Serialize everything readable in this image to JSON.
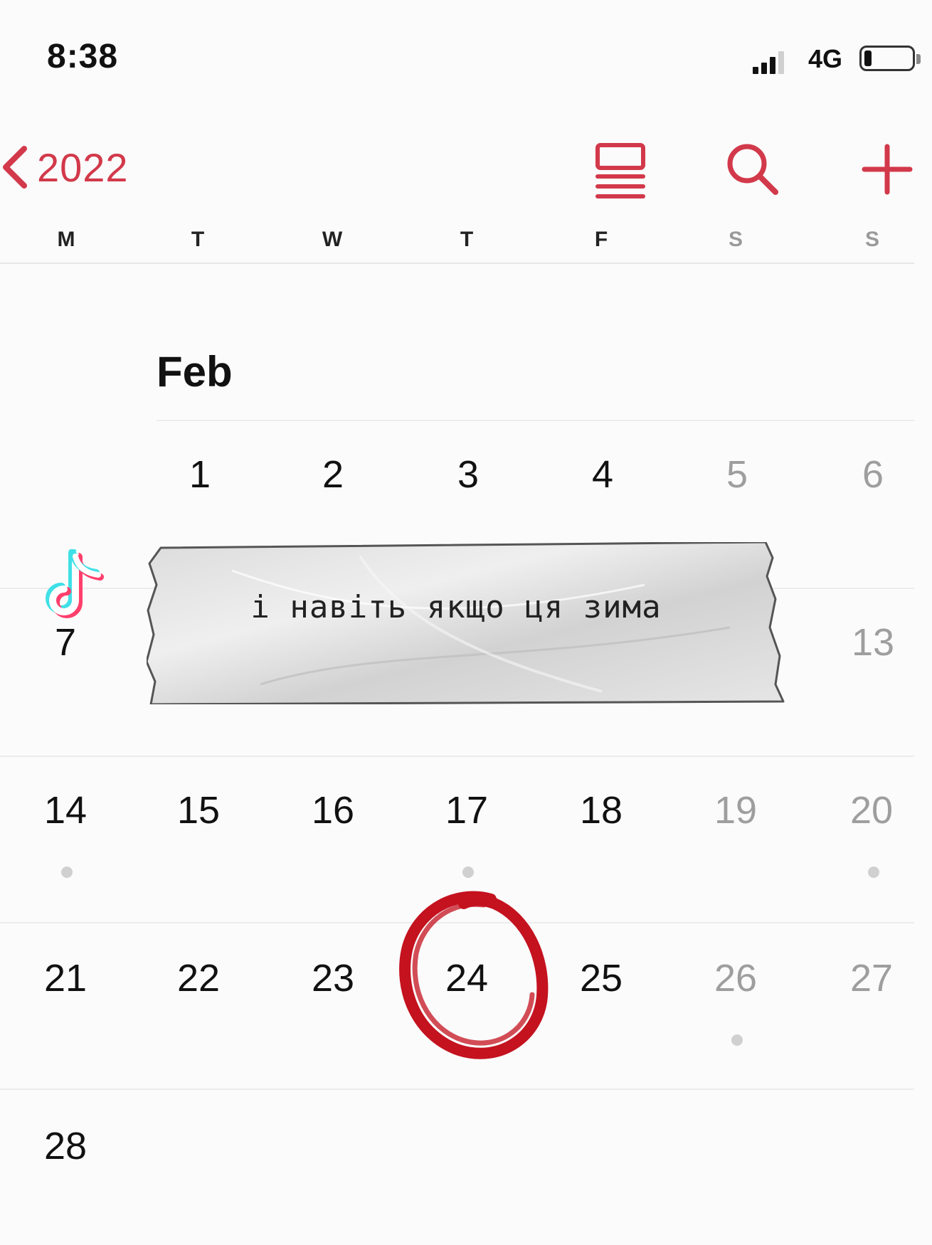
{
  "status_bar": {
    "time": "8:38",
    "network": "4G",
    "signal_bars_filled": 3,
    "battery_level": 0.15
  },
  "nav": {
    "back_label": "2022",
    "accent_color": "#d2394a",
    "icons": [
      "chevron-left-icon",
      "list-icon",
      "search-icon",
      "plus-icon"
    ]
  },
  "weekdays": [
    "M",
    "T",
    "W",
    "T",
    "F",
    "S",
    "S"
  ],
  "month": {
    "title": "Feb",
    "weeks": [
      [
        "",
        "1",
        "2",
        "3",
        "4",
        "5",
        "6"
      ],
      [
        "7",
        "",
        "",
        "",
        "",
        "",
        "13"
      ],
      [
        "14",
        "15",
        "16",
        "17",
        "18",
        "19",
        "20"
      ],
      [
        "21",
        "22",
        "23",
        "24",
        "25",
        "26",
        "27"
      ],
      [
        "28",
        "",
        "",
        "",
        "",
        "",
        ""
      ]
    ],
    "circled_day": "24"
  },
  "sticker": {
    "text": "і навіть якщо ця зима"
  },
  "colors": {
    "circle": "#c4121f",
    "weekend_text": "#9e9e9e"
  }
}
